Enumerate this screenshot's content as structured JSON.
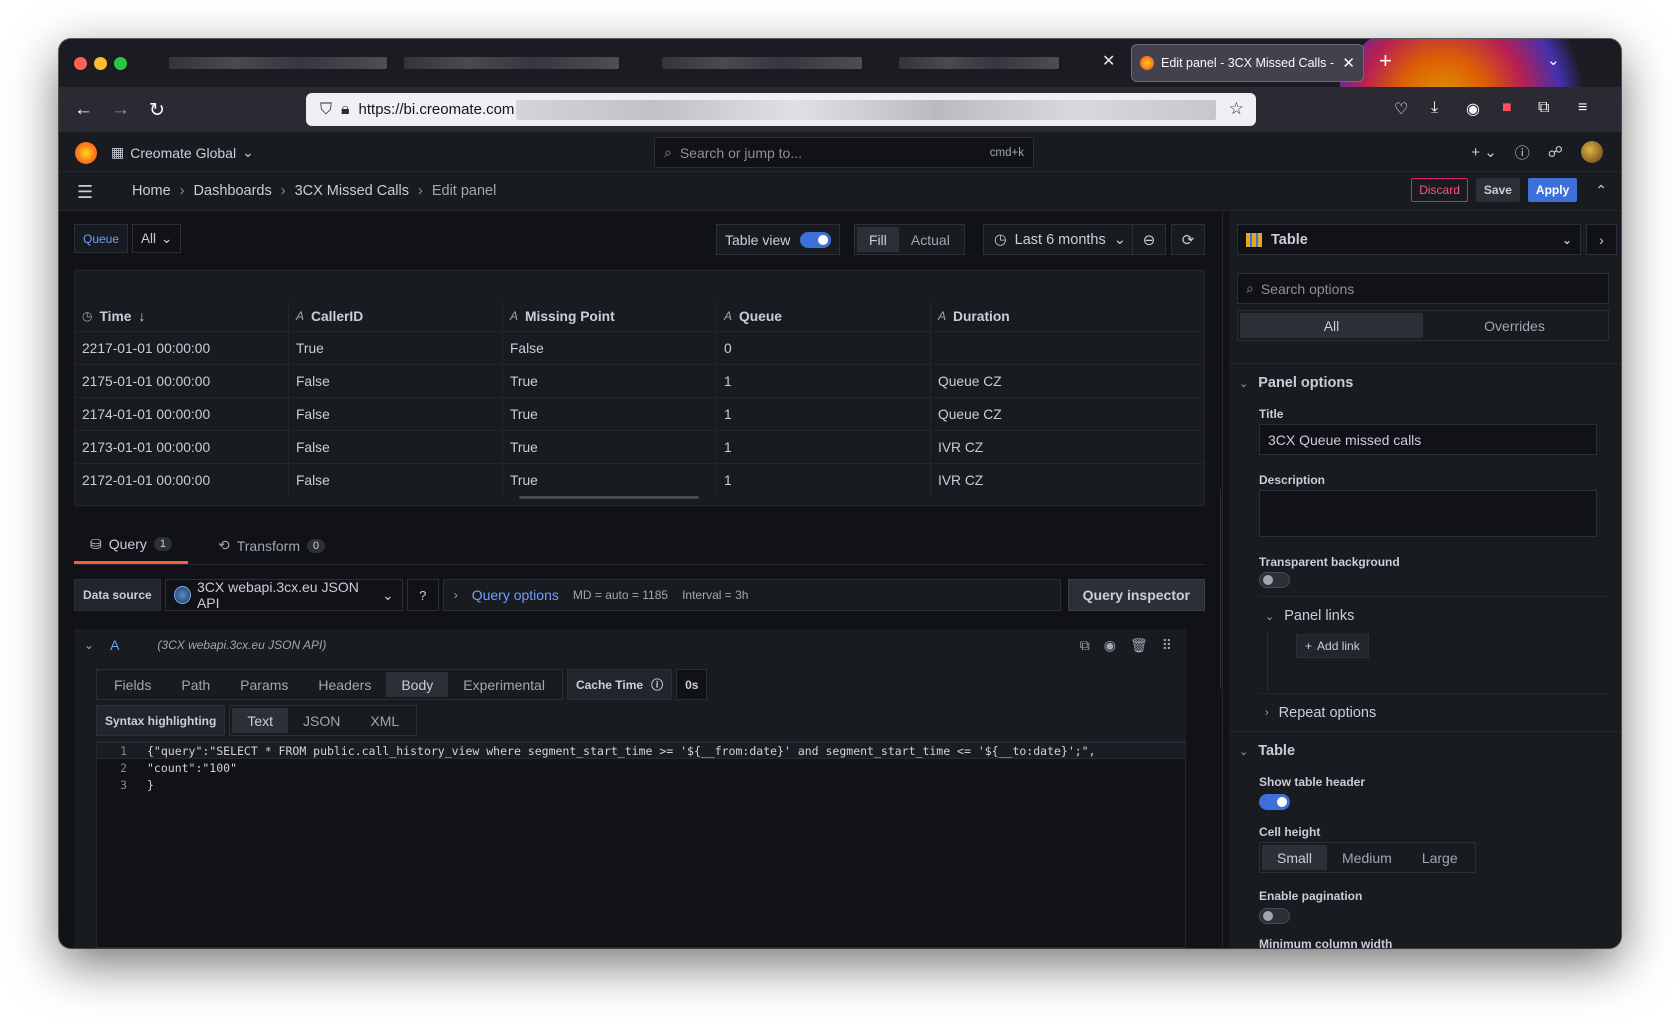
{
  "browser": {
    "active_tab_title": "Edit panel - 3CX Missed Calls -",
    "url_visible": "https://bi.creomate.com"
  },
  "topbar": {
    "org_name": "Creomate Global",
    "search_placeholder": "Search or jump to...",
    "search_shortcut": "cmd+k"
  },
  "breadcrumb": {
    "items": [
      "Home",
      "Dashboards",
      "3CX Missed Calls",
      "Edit panel"
    ]
  },
  "actions": {
    "discard": "Discard",
    "save": "Save",
    "apply": "Apply"
  },
  "variables": {
    "queue_label": "Queue",
    "queue_value": "All"
  },
  "panel_toolbar": {
    "table_view_label": "Table view",
    "table_view_on": true,
    "fill_label": "Fill",
    "actual_label": "Actual",
    "time_range": "Last 6 months"
  },
  "table": {
    "columns": [
      "Time",
      "CallerID",
      "Missing Point",
      "Queue",
      "Duration"
    ],
    "rows": [
      [
        "2217-01-01 00:00:00",
        "True",
        "False",
        "0",
        ""
      ],
      [
        "2175-01-01 00:00:00",
        "False",
        "True",
        "1",
        "Queue CZ"
      ],
      [
        "2174-01-01 00:00:00",
        "False",
        "True",
        "1",
        "Queue CZ"
      ],
      [
        "2173-01-01 00:00:00",
        "False",
        "True",
        "1",
        "IVR CZ"
      ],
      [
        "2172-01-01 00:00:00",
        "False",
        "True",
        "1",
        "IVR CZ"
      ]
    ]
  },
  "query_tabs": {
    "query_label": "Query",
    "query_count": "1",
    "transform_label": "Transform",
    "transform_count": "0"
  },
  "datasource": {
    "label": "Data source",
    "name": "3CX webapi.3cx.eu JSON API",
    "query_options_label": "Query options",
    "md": "MD = auto = 1185",
    "interval": "Interval = 3h",
    "inspector_label": "Query inspector"
  },
  "query": {
    "ref_id": "A",
    "ds_name": "(3CX webapi.3cx.eu JSON API)",
    "subtabs": [
      "Fields",
      "Path",
      "Params",
      "Headers",
      "Body",
      "Experimental"
    ],
    "active_subtab": "Body",
    "cache_time_label": "Cache Time",
    "cache_time_value": "0s",
    "syntax_label": "Syntax highlighting",
    "syntax_options": [
      "Text",
      "JSON",
      "XML"
    ],
    "active_syntax": "Text",
    "code_lines": [
      {
        "n": "1",
        "text": "{\"query\":\"SELECT * FROM public.call_history_view where segment_start_time >= '${__from:date}' and segment_start_time <= '${__to:date}';\","
      },
      {
        "n": "2",
        "text": "\"count\":\"100\""
      },
      {
        "n": "3",
        "text": "}"
      }
    ]
  },
  "options": {
    "viz_name": "Table",
    "search_placeholder": "Search options",
    "tab_all": "All",
    "tab_overrides": "Overrides",
    "panel_options_title": "Panel options",
    "title_label": "Title",
    "title_value": "3CX Queue missed calls",
    "description_label": "Description",
    "transparent_label": "Transparent background",
    "panel_links_label": "Panel links",
    "add_link_label": "Add link",
    "repeat_options_label": "Repeat options",
    "table_section": "Table",
    "show_header_label": "Show table header",
    "cell_height_label": "Cell height",
    "cell_heights": [
      "Small",
      "Medium",
      "Large"
    ],
    "active_cell_height": "Small",
    "pagination_label": "Enable pagination",
    "min_col_width_label": "Minimum column width"
  }
}
